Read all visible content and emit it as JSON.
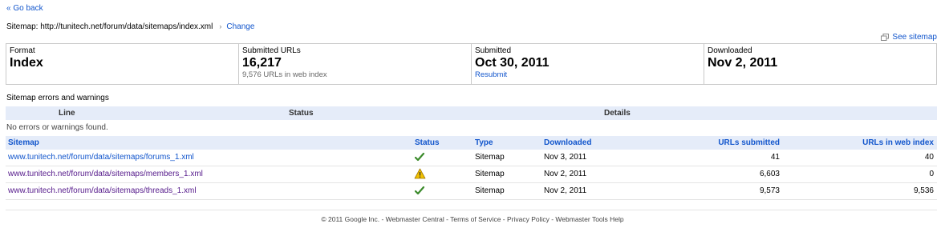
{
  "nav": {
    "go_back": "« Go back"
  },
  "sitemap": {
    "label": "Sitemap: http://tunitech.net/forum/data/sitemaps/index.xml",
    "separator": "›",
    "change": "Change",
    "see_sitemap": "See sitemap"
  },
  "summary": {
    "format_label": "Format",
    "format_value": "Index",
    "submitted_urls_label": "Submitted URLs",
    "submitted_urls_value": "16,217",
    "submitted_urls_sub": "9,576 URLs in web index",
    "submitted_label": "Submitted",
    "submitted_value": "Oct 30, 2011",
    "resubmit": "Resubmit",
    "downloaded_label": "Downloaded",
    "downloaded_value": "Nov 2, 2011"
  },
  "errors": {
    "title": "Sitemap errors and warnings",
    "headers": [
      "Line",
      "Status",
      "Details"
    ],
    "empty": "No errors or warnings found."
  },
  "sitemaps": {
    "headers": {
      "sitemap": "Sitemap",
      "status": "Status",
      "type": "Type",
      "downloaded": "Downloaded",
      "urls_submitted": "URLs submitted",
      "urls_in_index": "URLs in web index"
    },
    "rows": [
      {
        "url": "www.tunitech.net/forum/data/sitemaps/forums_1.xml",
        "status": "check-icon",
        "type": "Sitemap",
        "downloaded": "Nov 3, 2011",
        "submitted": "41",
        "indexed": "40"
      },
      {
        "url": "www.tunitech.net/forum/data/sitemaps/members_1.xml",
        "status": "warning-icon",
        "type": "Sitemap",
        "downloaded": "Nov 2, 2011",
        "submitted": "6,603",
        "indexed": "0"
      },
      {
        "url": "www.tunitech.net/forum/data/sitemaps/threads_1.xml",
        "status": "check-icon",
        "type": "Sitemap",
        "downloaded": "Nov 2, 2011",
        "submitted": "9,573",
        "indexed": "9,536"
      }
    ]
  },
  "footer": {
    "text": "© 2011 Google Inc. - Webmaster Central - Terms of Service - Privacy Policy - Webmaster Tools Help"
  },
  "colors": {
    "link": "#1155cc",
    "visited": "#551a8b",
    "header_bg": "#e5ecf9",
    "check": "#3a8a2a",
    "warning": "#e8b800"
  }
}
